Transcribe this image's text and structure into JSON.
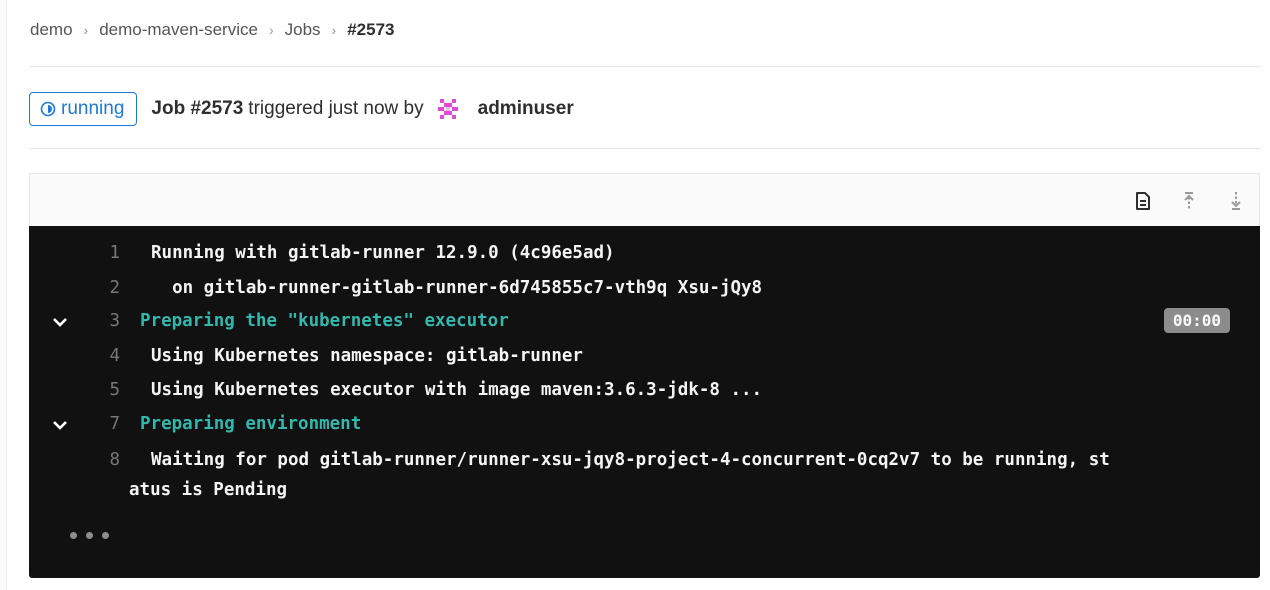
{
  "breadcrumb": {
    "items": [
      "demo",
      "demo-maven-service",
      "Jobs",
      "#2573"
    ],
    "separator": "›"
  },
  "job": {
    "status": "running",
    "status_color": "#1f78d1",
    "title": "Job #2573",
    "trigger_text": "triggered just now by",
    "user": "adminuser",
    "avatar_icon": "identicon-avatar"
  },
  "toolbar": {
    "icons": [
      "raw-log-icon",
      "scroll-to-top-icon",
      "scroll-to-bottom-icon"
    ]
  },
  "log": {
    "lines": [
      {
        "num": "1",
        "text": "Running with gitlab-runner 12.9.0 (4c96e5ad)"
      },
      {
        "num": "2",
        "text": "  on gitlab-runner-gitlab-runner-6d745855c7-vth9q Xsu-jQy8"
      },
      {
        "num": "3",
        "text": "Preparing the \"kubernetes\" executor",
        "duration": "00:00"
      },
      {
        "num": "4",
        "text": "Using Kubernetes namespace: gitlab-runner"
      },
      {
        "num": "5",
        "text": "Using Kubernetes executor with image maven:3.6.3-jdk-8 ..."
      },
      {
        "num": "7",
        "text": "Preparing environment"
      },
      {
        "num": "8",
        "text": "Waiting for pod gitlab-runner/runner-xsu-jqy8-project-4-concurrent-0cq2v7 to be running, st",
        "continuation": "atus is Pending"
      }
    ],
    "section_color": "#34b7ad",
    "background": "#111111"
  }
}
